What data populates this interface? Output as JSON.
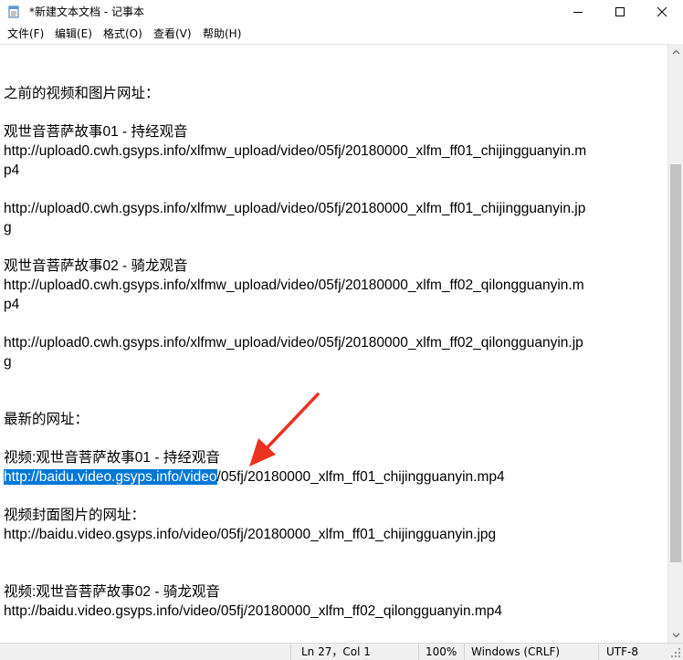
{
  "window": {
    "title": "*新建文本文档 - 记事本",
    "minimize_icon": "minimize-icon",
    "maximize_icon": "maximize-icon",
    "close_icon": "close-icon"
  },
  "menu": {
    "items": [
      {
        "label": "文件(F)"
      },
      {
        "label": "编辑(E)"
      },
      {
        "label": "格式(O)"
      },
      {
        "label": "查看(V)"
      },
      {
        "label": "帮助(H)"
      }
    ]
  },
  "editor": {
    "lines": [
      {
        "text": "之前的视频和图片网址："
      },
      {
        "text": "观世音菩萨故事01 - 持经观音"
      },
      {
        "text": "http://upload0.cwh.gsyps.info/xlfmw_upload/video/05fj/20180000_xlfm_ff01_chijingguanyin.m"
      },
      {
        "text": "p4"
      },
      {
        "text": "http://upload0.cwh.gsyps.info/xlfmw_upload/video/05fj/20180000_xlfm_ff01_chijingguanyin.jp"
      },
      {
        "text": "g"
      },
      {
        "text": "观世音菩萨故事02 - 骑龙观音"
      },
      {
        "text": "http://upload0.cwh.gsyps.info/xlfmw_upload/video/05fj/20180000_xlfm_ff02_qilongguanyin.m"
      },
      {
        "text": "p4"
      },
      {
        "text": "http://upload0.cwh.gsyps.info/xlfmw_upload/video/05fj/20180000_xlfm_ff02_qilongguanyin.jp"
      },
      {
        "text": "g"
      },
      {
        "text": "最新的网址："
      },
      {
        "text": "视频:观世音菩萨故事01 - 持经观音"
      },
      {
        "selected": "http://baidu.video.gsyps.info/video",
        "rest": "/05fj/20180000_xlfm_ff01_chijingguanyin.mp4"
      },
      {
        "text": "视频封面图片的网址："
      },
      {
        "text": "http://baidu.video.gsyps.info/video/05fj/20180000_xlfm_ff01_chijingguanyin.jpg"
      },
      {
        "text": "视频:观世音菩萨故事02 - 骑龙观音"
      },
      {
        "text": "http://baidu.video.gsyps.info/video/05fj/20180000_xlfm_ff02_qilongguanyin.mp4"
      }
    ]
  },
  "status": {
    "position": "Ln 27，Col 1",
    "zoom": "100%",
    "line_ending": "Windows (CRLF)",
    "encoding": "UTF-8"
  },
  "annotation": {
    "arrow_color": "#ea3323"
  }
}
